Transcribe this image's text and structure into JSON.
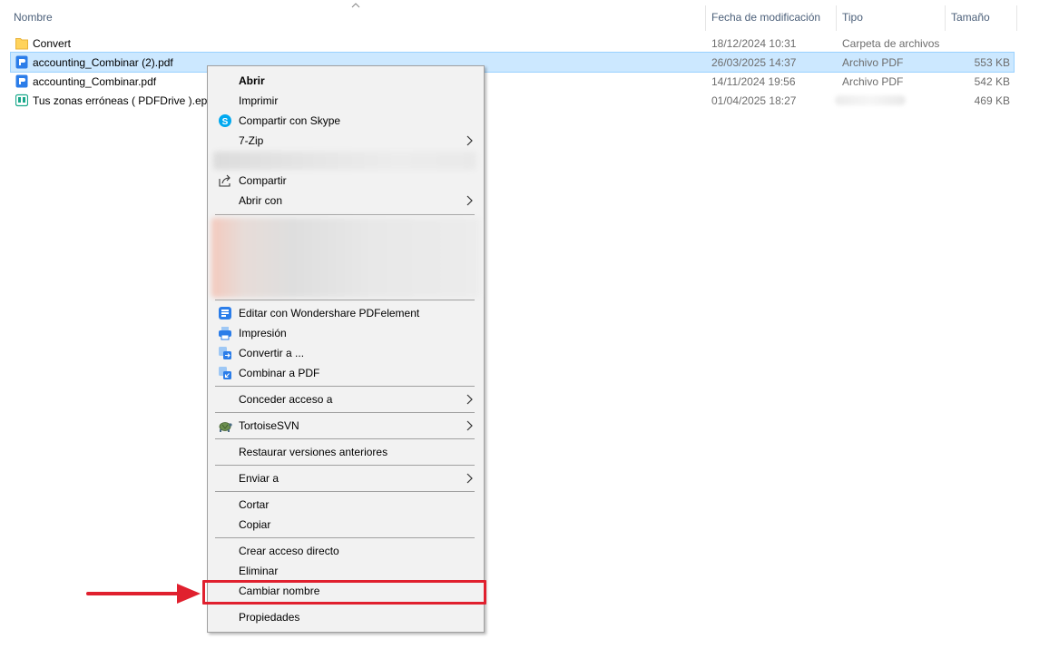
{
  "columns": {
    "name": "Nombre",
    "modified": "Fecha de modificación",
    "type": "Tipo",
    "size": "Tamaño"
  },
  "files": [
    {
      "name": "Convert",
      "modified": "18/12/2024 10:31",
      "type": "Carpeta de archivos",
      "size": "",
      "icon": "folder-icon",
      "selected": false
    },
    {
      "name": "accounting_Combinar (2).pdf",
      "modified": "26/03/2025 14:37",
      "type": "Archivo PDF",
      "size": "553 KB",
      "icon": "pdf-file-icon",
      "selected": true
    },
    {
      "name": "accounting_Combinar.pdf",
      "modified": "14/11/2024 19:56",
      "type": "Archivo PDF",
      "size": "542 KB",
      "icon": "pdf-file-icon",
      "selected": false
    },
    {
      "name": "Tus zonas erróneas ( PDFDrive ).epub",
      "modified": "01/04/2025 18:27",
      "type": "",
      "size": "469 KB",
      "icon": "epub-file-icon",
      "selected": false
    }
  ],
  "menu": {
    "open": "Abrir",
    "print": "Imprimir",
    "share_skype": "Compartir con Skype",
    "seven_zip": "7-Zip",
    "share": "Compartir",
    "open_with": "Abrir con",
    "edit_pdfelement": "Editar con Wondershare PDFelement",
    "impresion": "Impresión",
    "convert_to": "Convertir a ...",
    "combine_pdf": "Combinar a PDF",
    "grant_access": "Conceder acceso a",
    "tortoise": "TortoiseSVN",
    "restore": "Restaurar versiones anteriores",
    "send_to": "Enviar a",
    "cut": "Cortar",
    "copy": "Copiar",
    "create_shortcut": "Crear acceso directo",
    "delete": "Eliminar",
    "rename": "Cambiar nombre",
    "properties": "Propiedades"
  },
  "colors": {
    "selection": "#cce8ff",
    "highlight": "#e0202e",
    "header_text": "#4c607a",
    "accent": "#2b7de9"
  }
}
